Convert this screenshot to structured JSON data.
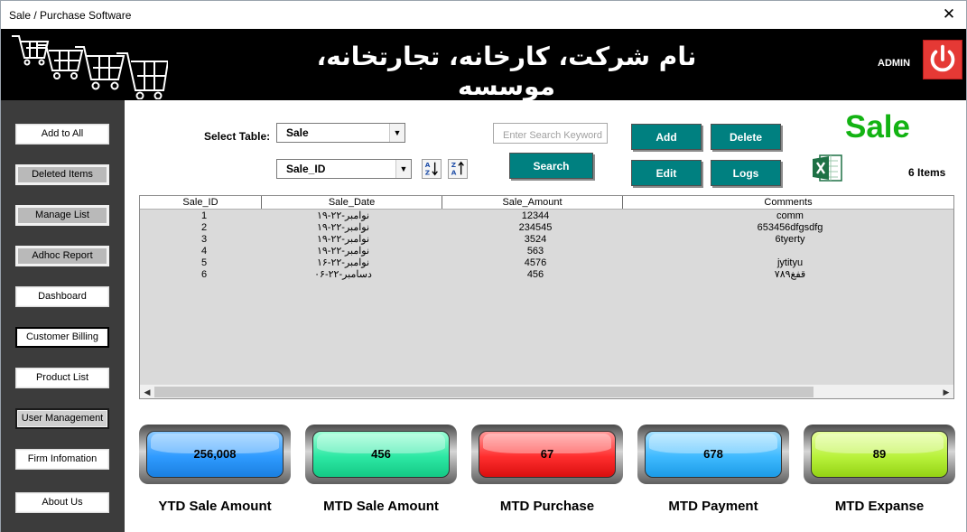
{
  "window": {
    "title": "Sale / Purchase Software",
    "close_glyph": "✕"
  },
  "banner": {
    "company_name": "نام شرکت، کارخانه، تجارتخانه، موسسه",
    "user": "ADMIN",
    "power_icon": "power-icon",
    "cart_icon": "shopping-cart-icon"
  },
  "sidebar": {
    "items": [
      {
        "label": "Add to All"
      },
      {
        "label": "Deleted Items"
      },
      {
        "label": "Manage List"
      },
      {
        "label": "Adhoc Report"
      },
      {
        "label": "Dashboard"
      },
      {
        "label": "Customer Billing"
      },
      {
        "label": "Product List"
      },
      {
        "label": "User Management"
      },
      {
        "label": "Firm Infomation"
      },
      {
        "label": "About Us"
      }
    ]
  },
  "controls": {
    "select_table_label": "Select Table:",
    "table_value": "Sale",
    "field_value": "Sale_ID",
    "search_placeholder": "Enter Search Keyword",
    "search_label": "Search",
    "add_label": "Add",
    "delete_label": "Delete",
    "edit_label": "Edit",
    "logs_label": "Logs",
    "sort_asc_icon": "sort-az-icon",
    "sort_desc_icon": "sort-za-icon",
    "excel_icon": "excel-icon"
  },
  "header": {
    "table_title": "Sale",
    "items_count": "6 Items"
  },
  "table": {
    "columns": [
      "Sale_ID",
      "Sale_Date",
      "Sale_Amount",
      "Comments"
    ],
    "rows": [
      [
        "1",
        "۱۹-نوامبر-۲۲",
        "12344",
        "comm"
      ],
      [
        "2",
        "۱۹-نوامبر-۲۲",
        "234545",
        "653456dfgsdfg"
      ],
      [
        "3",
        "۱۹-نوامبر-۲۲",
        "3524",
        "6tyerty"
      ],
      [
        "4",
        "۱۹-نوامبر-۲۲",
        "563",
        ""
      ],
      [
        "5",
        "۱۶-نوامبر-۲۲",
        "4576",
        "jytityu"
      ],
      [
        "6",
        "۰۶-دسامبر-۲۲",
        "456",
        "۷۸۹قفغ"
      ]
    ],
    "scroll_left": "◀",
    "scroll_right": "▶"
  },
  "kpis": [
    {
      "value": "256,008",
      "label": "YTD Sale Amount",
      "color": "#2f9bff"
    },
    {
      "value": "456",
      "label": "MTD Sale Amount",
      "color": "#2de8a4"
    },
    {
      "value": "67",
      "label": "MTD Purchase",
      "color": "#ff2e2e"
    },
    {
      "value": "678",
      "label": "MTD Payment",
      "color": "#3fbaff"
    },
    {
      "value": "89",
      "label": "MTD Expanse",
      "color": "#b9f23c"
    }
  ],
  "colors": {
    "accent_teal": "#008080",
    "title_green": "#13b313",
    "banner_bg": "#000000",
    "sidebar_bg": "#3c3c3c",
    "power_red": "#e53935"
  }
}
